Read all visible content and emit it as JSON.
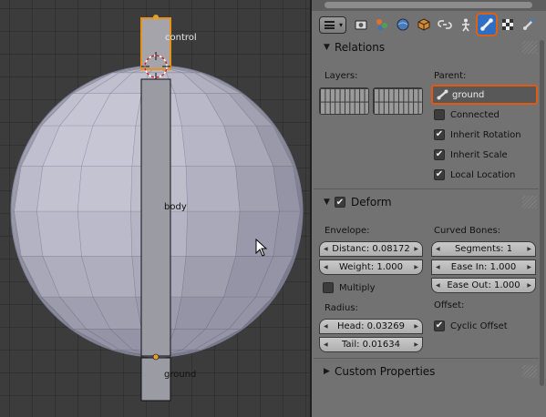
{
  "viewport": {
    "bones": [
      {
        "name": "control"
      },
      {
        "name": "body"
      },
      {
        "name": "ground"
      }
    ],
    "colors": {
      "sphere": "#9595a6",
      "bone": "#9b9ba3",
      "selected_outline": "#e8901a",
      "joint": "#e0a030"
    }
  },
  "properties": {
    "tabs": [
      {
        "icon": "render-icon",
        "active": false
      },
      {
        "icon": "scene-icon",
        "active": false
      },
      {
        "icon": "world-icon",
        "active": false
      },
      {
        "icon": "object-icon",
        "active": false
      },
      {
        "icon": "constraints-icon",
        "active": false
      },
      {
        "icon": "armature-data-icon",
        "active": false
      },
      {
        "icon": "bone-icon",
        "active": true
      },
      {
        "icon": "texture-icon",
        "active": false
      },
      {
        "icon": "bone-constraint-icon",
        "active": false
      }
    ],
    "relations": {
      "title": "Relations",
      "layers_label": "Layers:",
      "parent_label": "Parent:",
      "parent_value": "ground",
      "connected": {
        "label": "Connected",
        "checked": false
      },
      "inherit_rotation": {
        "label": "Inherit Rotation",
        "checked": true
      },
      "inherit_scale": {
        "label": "Inherit Scale",
        "checked": true
      },
      "local_location": {
        "label": "Local Location",
        "checked": true
      }
    },
    "deform": {
      "title": "Deform",
      "enabled": true,
      "envelope_label": "Envelope:",
      "distance": "Distanc: 0.08172",
      "weight": "Weight: 1.000",
      "multiply": {
        "label": "Multiply",
        "checked": false
      },
      "radius_label": "Radius:",
      "head": "Head: 0.03269",
      "tail": "Tail: 0.01634",
      "curved_bones_label": "Curved Bones:",
      "segments": "Segments: 1",
      "ease_in": "Ease In: 1.000",
      "ease_out": "Ease Out: 1.000",
      "offset_label": "Offset:",
      "cyclic_offset": {
        "label": "Cyclic Offset",
        "checked": true
      }
    },
    "custom_properties": {
      "title": "Custom Properties"
    }
  },
  "colors": {
    "accent": "#e4580f",
    "active_tab": "#2f6ec2",
    "panel_bg": "#727272"
  }
}
